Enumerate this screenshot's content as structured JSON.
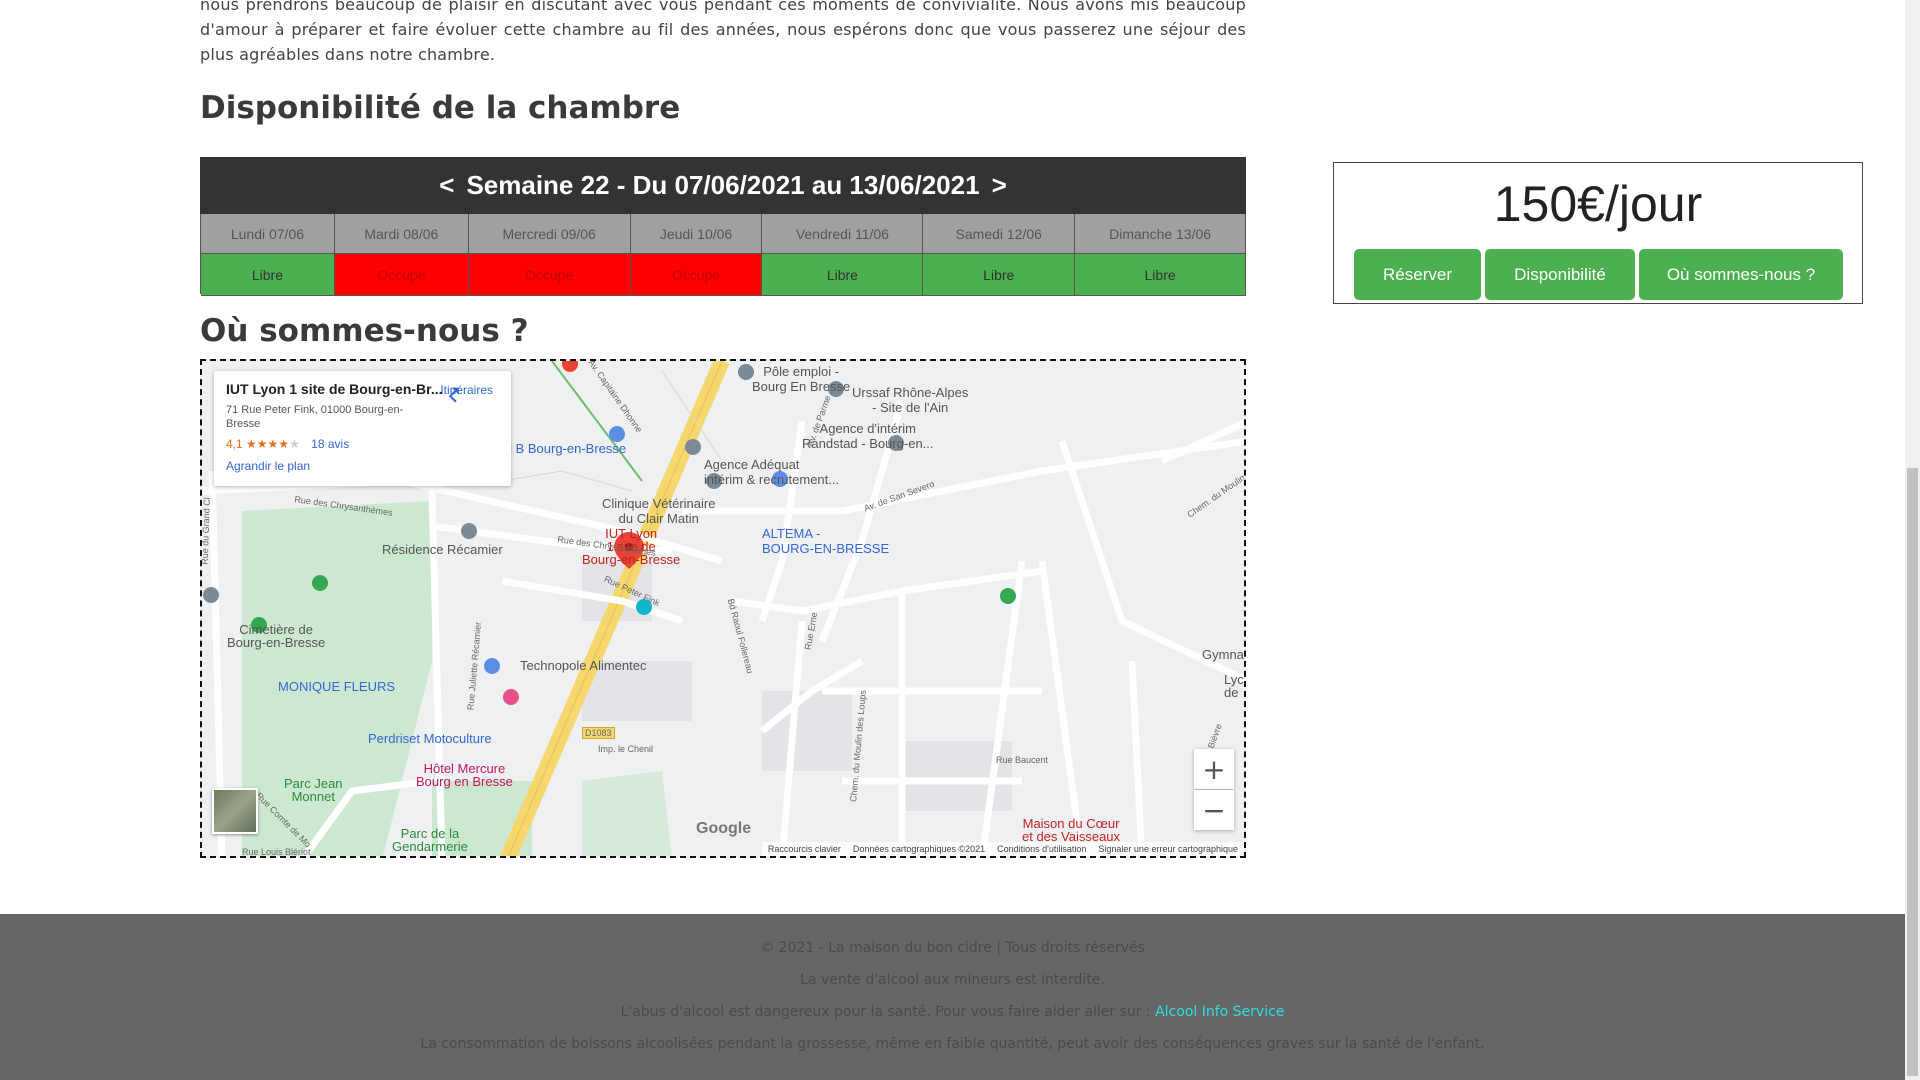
{
  "intro_text": "nous prendrons beaucoup de plaisir en discutant avec vous pendant ces moments de convivialité. Nous avons mis beaucoup d'amour à préparer et faire évoluer cette chambre au fil des années, nous espérons donc que vous passerez une séjour des plus agréables dans notre chambre.",
  "availability": {
    "title": "Disponibilité de la chambre",
    "prev": "<",
    "next": ">",
    "week_label": "Semaine 22 - Du 07/06/2021 au 13/06/2021",
    "days": [
      {
        "day": "Lundi 07/06",
        "status": "Libre"
      },
      {
        "day": "Mardi 08/06",
        "status": "Occupé"
      },
      {
        "day": "Mercredi 09/06",
        "status": "Occupé"
      },
      {
        "day": "Jeudi 10/06",
        "status": "Occupé"
      },
      {
        "day": "Vendredi 11/06",
        "status": "Libre"
      },
      {
        "day": "Samedi 12/06",
        "status": "Libre"
      },
      {
        "day": "Dimanche 13/06",
        "status": "Libre"
      }
    ]
  },
  "price_box": {
    "price": "150€/jour",
    "buttons": [
      "Réserver",
      "Disponibilité",
      "Où sommes-nous ?"
    ]
  },
  "location": {
    "title": "Où sommes-nous ?",
    "info_card": {
      "name": "IUT Lyon 1 site de Bourg-en-Br...",
      "address": "71 Rue Peter Fink, 01000 Bourg-en-Bresse",
      "rating": "4,1",
      "stars": "★★★★",
      "star_empty": "★",
      "reviews": "18 avis",
      "enlarge": "Agrandir le plan",
      "directions": "Itinéraires"
    },
    "places": {
      "pole_emploi": "Pôle emploi -\nBourg En Bresse",
      "urssaf": "Urssaf Rhône-Alpes\n- Site de l'Ain",
      "randstad": "Agence d'intérim\nRandstad - Bourg-en...",
      "vandb": "V and B Bourg-en-Bresse",
      "adequat": "Agence Adéquat\nintérim & recrutement...",
      "clinique": "Clinique Vétérinaire\ndu Clair Matin",
      "altema": "ALTEMA -\nBOURG-EN-BRESSE",
      "iut": "IUT Lyon\n1 site de\nBourg-en-Bresse",
      "recamier": "Résidence Récamier",
      "cimetiere": "Cimetière de\nBourg-en-Bresse",
      "technopole": "Technopole Alimentec",
      "monique": "MONIQUE FLEURS",
      "perdriset": "Perdriset Motoculture",
      "mercure": "Hôtel Mercure\nBourg en Bresse",
      "parc_monnet": "Parc Jean\nMonnet",
      "parc_gend": "Parc de la\nGendarmerie",
      "maison_coeur": "Maison du Cœur\net des Vaisseaux",
      "gymna": "Gymna",
      "lyc": "Lyc\nde"
    },
    "streets": {
      "chrysanthemes1": "Rue des Chrysanthèmes",
      "chrysanthemes2": "Rue des Chrysanthèmes",
      "peter_fink": "Rue Peter Fink",
      "grand_cl": "Rue du Grand Cl",
      "juliette": "Rue Juliette Récamier",
      "capitaine": "Av. Capitaine Dhonne",
      "parme": "Av. de Parme",
      "san_severo": "Av. de San Severo",
      "moulin": "Chem. du Moulin",
      "moulin_loups": "Chem. du Moulin des Loups",
      "raoul": "Bd Raoul Follereau",
      "erne": "Rue Erne",
      "baucent": "Rue Baucent",
      "chenil": "Imp. le Chenil",
      "d1083": "D1083",
      "comte": "Rue Comte de Mo",
      "bleriot": "Rue Louis Blériot",
      "bievre": "Bièvre"
    },
    "google": "Google",
    "attribution": [
      "Raccourcis clavier",
      "Données cartographiques ©2021",
      "Conditions d'utilisation",
      "Signaler une erreur cartographique"
    ],
    "zoom_in": "+",
    "zoom_out": "−"
  },
  "footer": {
    "line1": "© 2021 - La maison du bon cidre | Tous droits réservés",
    "line2": "La vente d'alcool aux mineurs est interdite.",
    "line3": "L'abus d'alcool est dangereux pour la santé. Pour vous faire aider aller sur :",
    "link": "Alcool Info Service",
    "line4": "La consommation de boissons alcoolisées pendant la grossesse, même en faible quantité, peut avoir des conséquences graves sur la santé de l'enfant."
  }
}
